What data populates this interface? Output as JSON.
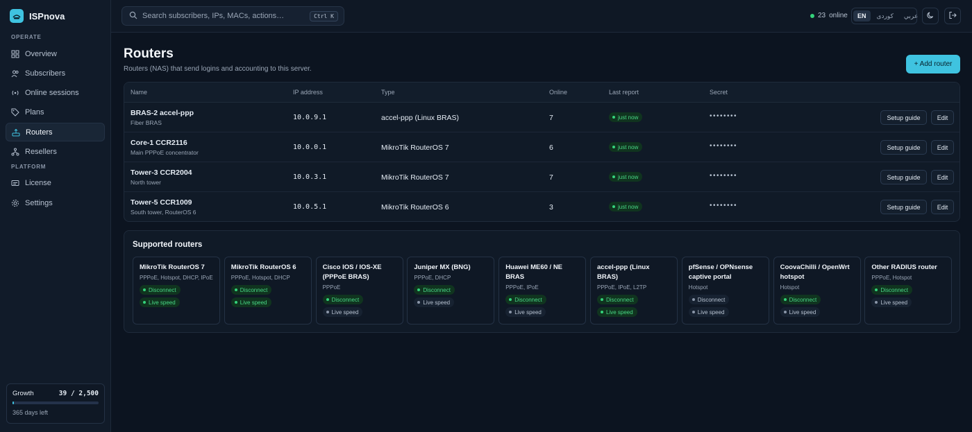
{
  "brand": {
    "name": "ISPnova"
  },
  "sidebar": {
    "section_operate": "OPERATE",
    "section_platform": "PLATFORM",
    "items": [
      {
        "label": "Overview",
        "icon": "grid-icon"
      },
      {
        "label": "Subscribers",
        "icon": "users-icon"
      },
      {
        "label": "Online sessions",
        "icon": "broadcast-icon"
      },
      {
        "label": "Plans",
        "icon": "tag-icon"
      },
      {
        "label": "Routers",
        "icon": "router-icon",
        "active": true
      },
      {
        "label": "Resellers",
        "icon": "network-icon"
      },
      {
        "label": "License",
        "icon": "card-icon"
      },
      {
        "label": "Settings",
        "icon": "gear-icon"
      }
    ],
    "growth": {
      "label": "Growth",
      "value": "39 / 2,500",
      "sub": "365 days left",
      "progress": 0.0156
    }
  },
  "topbar": {
    "search_placeholder": "Search subscribers, IPs, MACs, actions…",
    "shortcut": "Ctrl K",
    "online_count": "23",
    "online_label": "online",
    "languages": [
      "EN",
      "کوردی",
      "عربي"
    ],
    "active_language": "EN"
  },
  "page": {
    "title": "Routers",
    "subtitle": "Routers (NAS) that send logins and accounting to this server.",
    "add_button": "+ Add router"
  },
  "table": {
    "headers": [
      "Name",
      "IP address",
      "Type",
      "Online",
      "Last report",
      "Secret"
    ],
    "rows": [
      {
        "name": "BRAS-2 accel-ppp",
        "desc": "Fiber BRAS",
        "ip": "10.0.9.1",
        "type": "accel-ppp (Linux BRAS)",
        "online": "7",
        "last_report": "just now",
        "secret": "••••••••"
      },
      {
        "name": "Core-1 CCR2116",
        "desc": "Main PPPoE concentrator",
        "ip": "10.0.0.1",
        "type": "MikroTik RouterOS 7",
        "online": "6",
        "last_report": "just now",
        "secret": "••••••••"
      },
      {
        "name": "Tower-3 CCR2004",
        "desc": "North tower",
        "ip": "10.0.3.1",
        "type": "MikroTik RouterOS 7",
        "online": "7",
        "last_report": "just now",
        "secret": "••••••••"
      },
      {
        "name": "Tower-5 CCR1009",
        "desc": "South tower, RouterOS 6",
        "ip": "10.0.5.1",
        "type": "MikroTik RouterOS 6",
        "online": "3",
        "last_report": "just now",
        "secret": "••••••••"
      }
    ],
    "setup_label": "Setup guide",
    "edit_label": "Edit"
  },
  "supported": {
    "title": "Supported routers",
    "disconnect_label": "Disconnect",
    "live_label": "Live speed",
    "cards": [
      {
        "name": "MikroTik RouterOS 7",
        "protocols": "PPPoE, Hotspot, DHCP, IPoE",
        "disconnect": true,
        "live": true
      },
      {
        "name": "MikroTik RouterOS 6",
        "protocols": "PPPoE, Hotspot, DHCP",
        "disconnect": true,
        "live": true
      },
      {
        "name": "Cisco IOS / IOS-XE (PPPoE BRAS)",
        "protocols": "PPPoE",
        "disconnect": true,
        "live": false
      },
      {
        "name": "Juniper MX (BNG)",
        "protocols": "PPPoE, DHCP",
        "disconnect": true,
        "live": false
      },
      {
        "name": "Huawei ME60 / NE BRAS",
        "protocols": "PPPoE, IPoE",
        "disconnect": true,
        "live": false
      },
      {
        "name": "accel-ppp (Linux BRAS)",
        "protocols": "PPPoE, IPoE, L2TP",
        "disconnect": true,
        "live": true
      },
      {
        "name": "pfSense / OPNsense captive portal",
        "protocols": "Hotspot",
        "disconnect": false,
        "live": false
      },
      {
        "name": "CoovaChilli / OpenWrt hotspot",
        "protocols": "Hotspot",
        "disconnect": true,
        "live": false
      },
      {
        "name": "Other RADIUS router",
        "protocols": "PPPoE, Hotspot",
        "disconnect": true,
        "live": false
      }
    ]
  }
}
